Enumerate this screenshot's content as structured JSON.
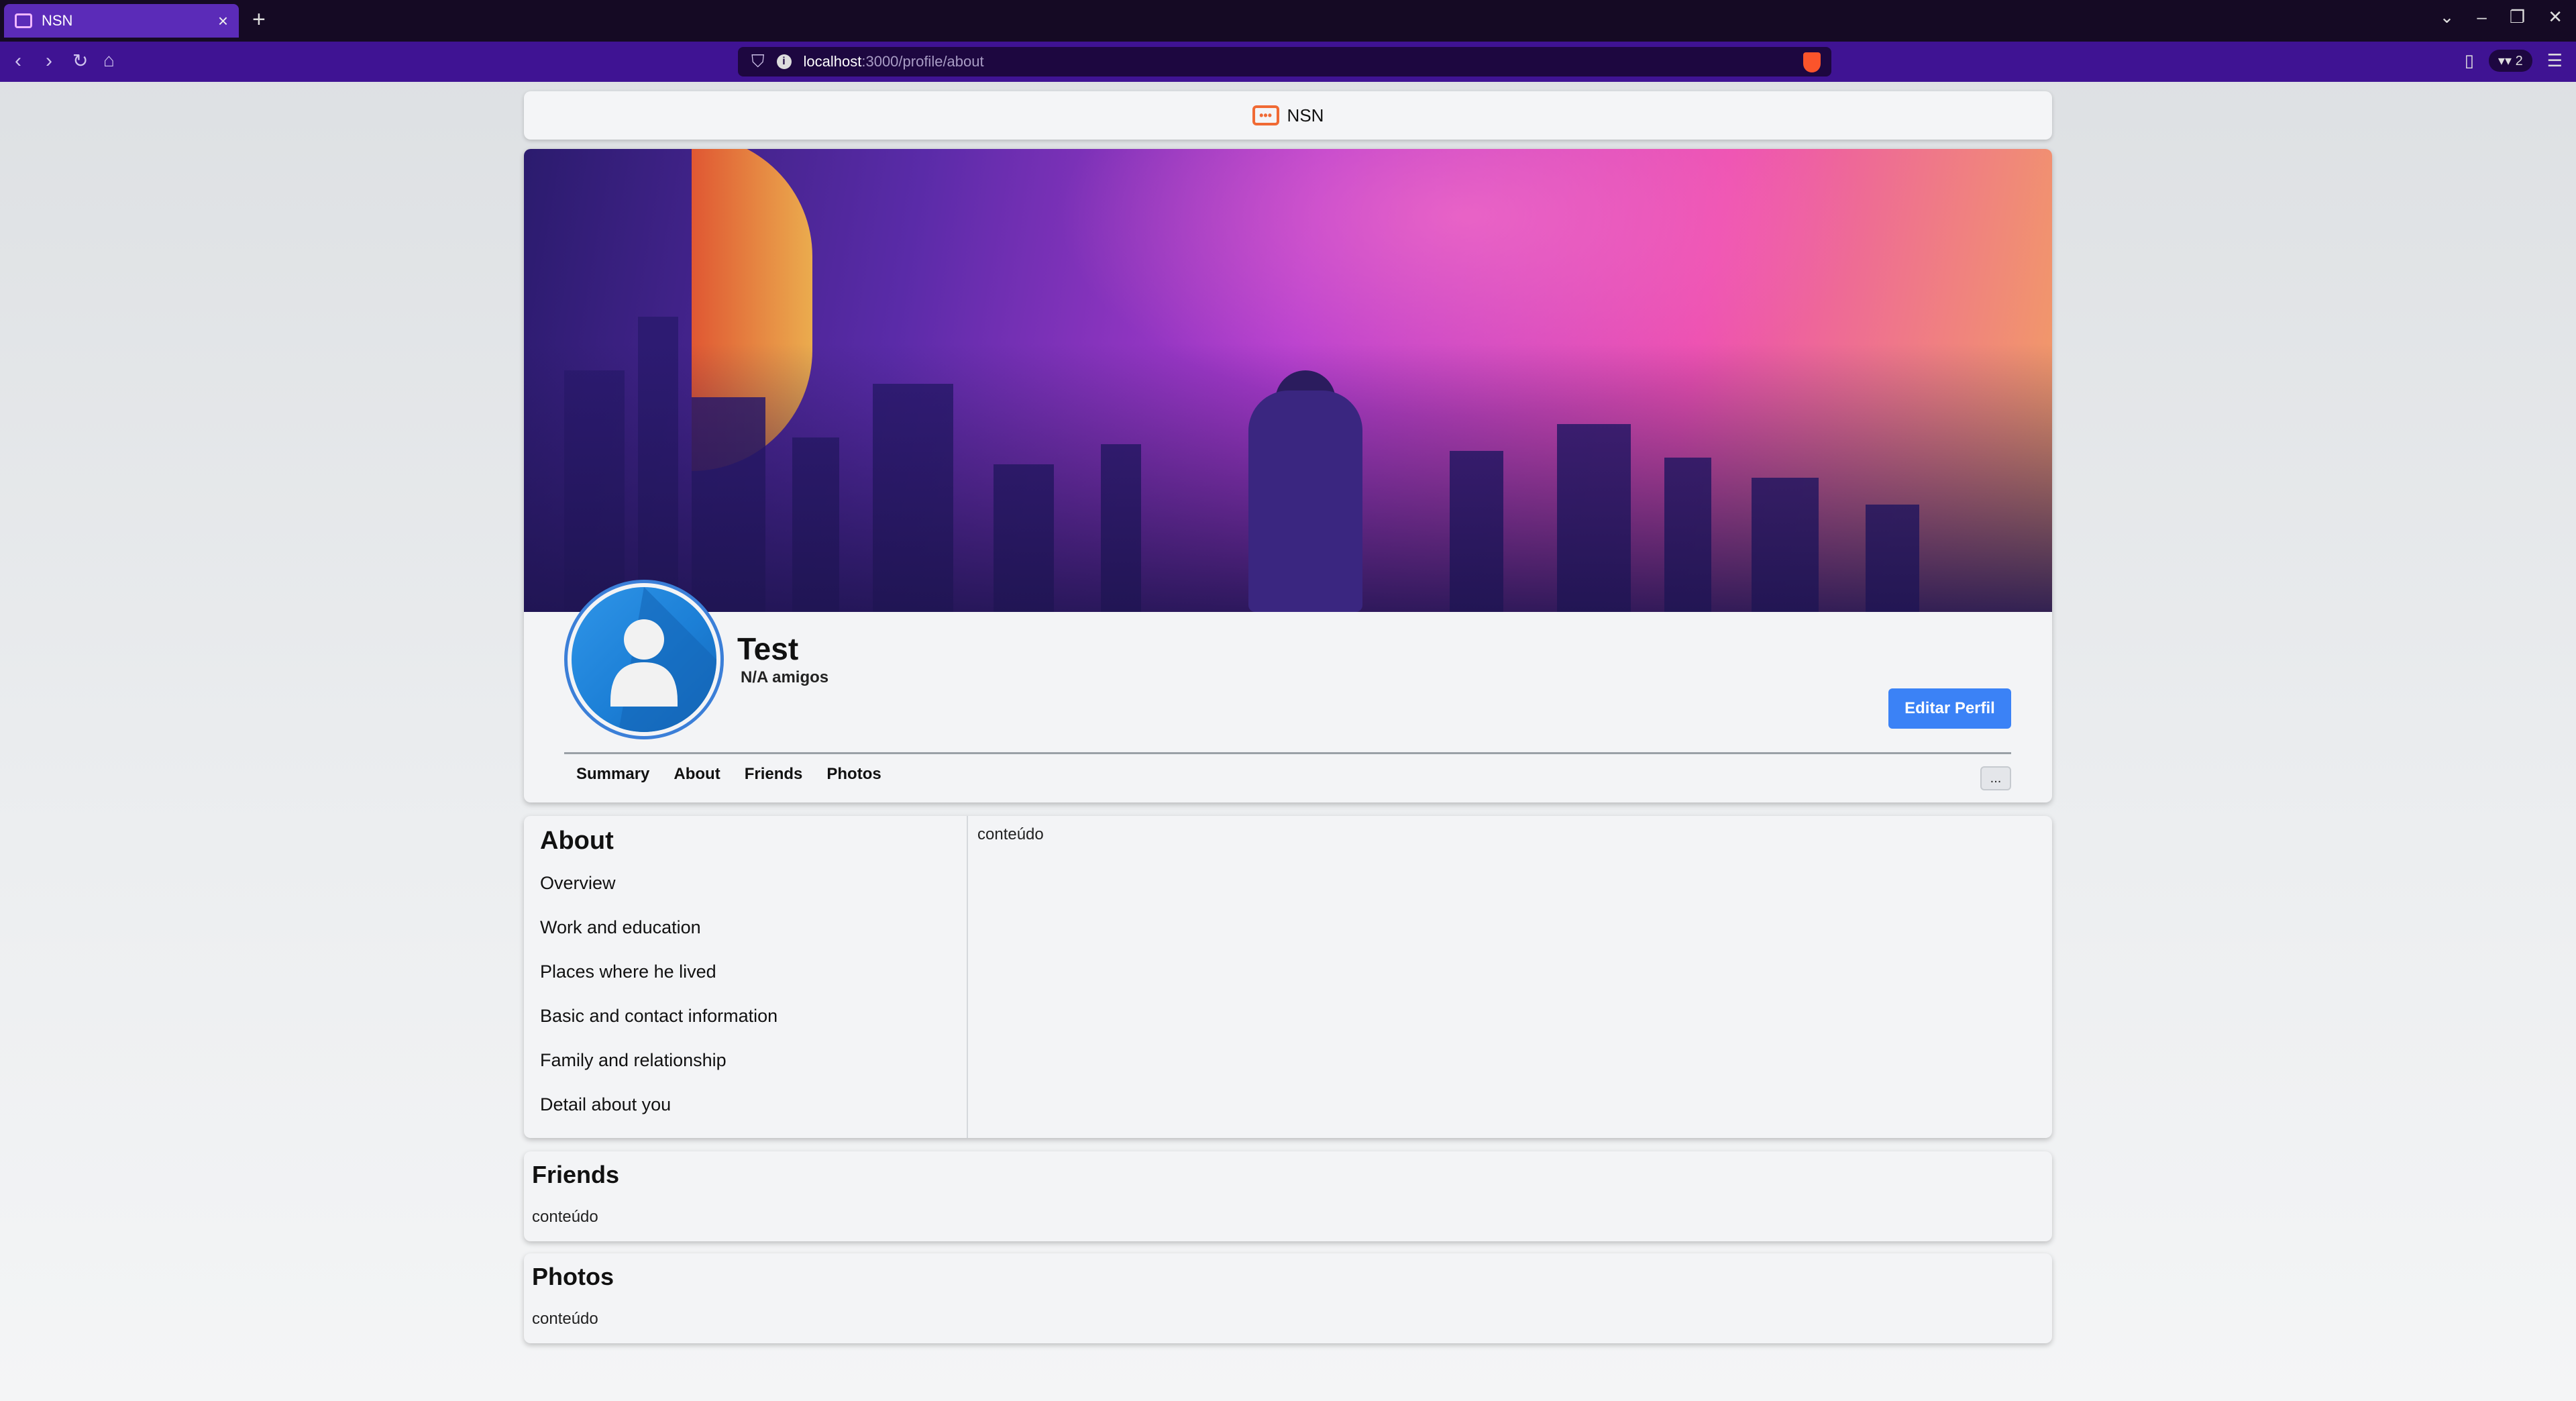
{
  "browser": {
    "tab_title": "NSN",
    "new_tab_label": "+",
    "tab_close_label": "×",
    "url_host": "localhost",
    "url_path": ":3000/profile/about",
    "wallet_count": "2"
  },
  "header": {
    "brand": "NSN",
    "logo_glyph": "•••"
  },
  "profile": {
    "name": "Test",
    "friends_count_text": "N/A amigos",
    "edit_button_label": "Editar Perfil",
    "more_button_label": "...",
    "tabs": [
      "Summary",
      "About",
      "Friends",
      "Photos"
    ]
  },
  "about": {
    "title": "About",
    "menu": [
      "Overview",
      "Work and education",
      "Places where he lived",
      "Basic and contact information",
      "Family and relationship",
      "Detail about you"
    ],
    "content": "conteúdo"
  },
  "friends_section": {
    "title": "Friends",
    "content": "conteúdo"
  },
  "photos_section": {
    "title": "Photos",
    "content": "conteúdo"
  },
  "colors": {
    "accent": "#3b82f6",
    "browser_tab": "#5b2bb8",
    "browser_nav": "#3f1393",
    "logo": "#f06a34"
  },
  "icons": [
    "chat-bubble-icon",
    "back-icon",
    "forward-icon",
    "reload-icon",
    "home-icon",
    "bookmark-icon",
    "info-icon",
    "brave-shield-icon",
    "sidebar-icon",
    "wallet-icon",
    "menu-icon",
    "chevron-down-icon",
    "minimize-icon",
    "maximize-icon",
    "close-icon",
    "user-avatar-icon"
  ]
}
